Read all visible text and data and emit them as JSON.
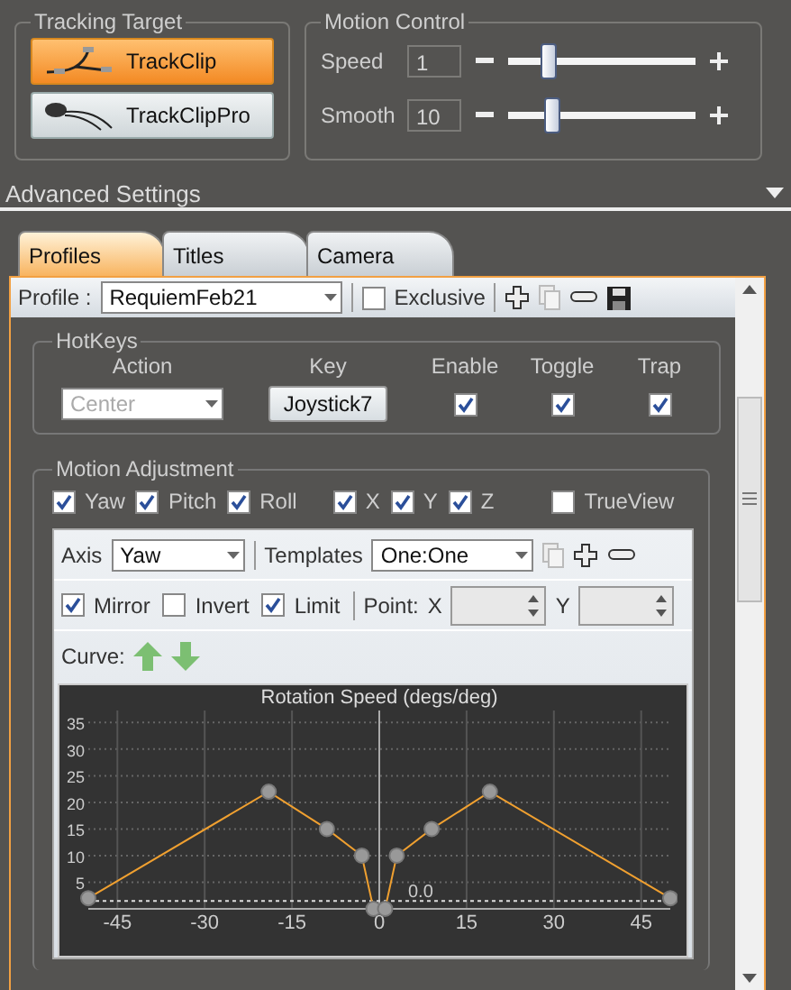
{
  "tracking_target": {
    "title": "Tracking Target",
    "devices": [
      {
        "label": "TrackClip",
        "kind": "clip",
        "selected": true
      },
      {
        "label": "TrackClipPro",
        "kind": "pro",
        "selected": false
      }
    ]
  },
  "motion_control": {
    "title": "Motion Control",
    "sliders": [
      {
        "label": "Speed",
        "value": "1",
        "level": 0.21
      },
      {
        "label": "Smooth",
        "value": "10",
        "level": 0.23
      }
    ]
  },
  "advanced_settings": {
    "title": "Advanced Settings"
  },
  "tabs": [
    {
      "label": "Profiles",
      "selected": true
    },
    {
      "label": "Titles",
      "selected": false
    },
    {
      "label": "Camera",
      "selected": false
    }
  ],
  "profile": {
    "label": "Profile :",
    "value": "RequiemFeb21",
    "exclusive": {
      "label": "Exclusive",
      "checked": false
    }
  },
  "hotkeys": {
    "title": "HotKeys",
    "columns": [
      "Action",
      "Key",
      "Enable",
      "Toggle",
      "Trap"
    ],
    "action": {
      "placeholder": "Center"
    },
    "key": "Joystick7",
    "enable": true,
    "toggle": true,
    "trap": true
  },
  "motion_adjustment": {
    "title": "Motion Adjustment",
    "axes": [
      {
        "label": "Yaw",
        "checked": true
      },
      {
        "label": "Pitch",
        "checked": true
      },
      {
        "label": "Roll",
        "checked": true
      },
      {
        "label": "X",
        "checked": true
      },
      {
        "label": "Y",
        "checked": true
      },
      {
        "label": "Z",
        "checked": true
      },
      {
        "label": "TrueView",
        "checked": false
      }
    ],
    "axis": {
      "label": "Axis",
      "value": "Yaw"
    },
    "templates": {
      "label": "Templates",
      "value": "One:One"
    },
    "options": [
      {
        "label": "Mirror",
        "checked": true
      },
      {
        "label": "Invert",
        "checked": false
      },
      {
        "label": "Limit",
        "checked": true
      }
    ],
    "point": {
      "label": "Point:",
      "x_label": "X",
      "y_label": "Y"
    },
    "curve_label": "Curve:",
    "chart_data": {
      "type": "line",
      "title": "Rotation Speed (degs/deg)",
      "x": [
        -50,
        -19,
        -9,
        -3,
        -1,
        1,
        3,
        9,
        19,
        50
      ],
      "series": [
        {
          "color": "#f0a030",
          "marker": "o",
          "values": [
            2,
            22,
            15,
            10,
            0,
            0,
            10,
            15,
            22,
            2
          ]
        }
      ],
      "xlim": [
        -50,
        50
      ],
      "ylim": [
        0,
        42
      ],
      "xticks": [
        -45,
        -30,
        -15,
        0,
        15,
        30,
        45
      ],
      "yticks": [
        5,
        10,
        15,
        20,
        25,
        30,
        35
      ],
      "grid": true,
      "ref_lines": [
        {
          "axis": "y",
          "value": 1.5
        }
      ],
      "annotations": [
        "0.0"
      ]
    }
  }
}
